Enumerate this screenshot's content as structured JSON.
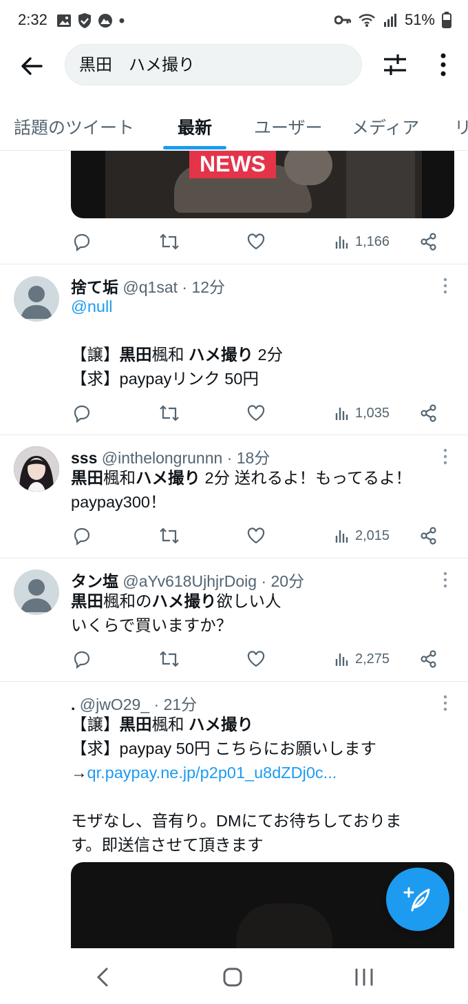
{
  "status_bar": {
    "time": "2:32",
    "battery": "51%"
  },
  "search": {
    "query": "黒田　ハメ撮り"
  },
  "tabs": [
    {
      "label": "話題のツイート"
    },
    {
      "label": "最新"
    },
    {
      "label": "ユーザー"
    },
    {
      "label": "メディア"
    },
    {
      "label": "リ"
    }
  ],
  "tweet0": {
    "media_caption": "NEWS",
    "views": "1,166"
  },
  "tweets": [
    {
      "name": "捨て垢",
      "handle": "@q1sat",
      "time": "· 12分",
      "mention": "@null",
      "line1_a": "【譲】",
      "line1_b": "黒田",
      "line1_c": "楓和 ",
      "line1_d": "ハメ撮り",
      "line1_e": " 2分",
      "line2": "【求】paypayリンク 50円",
      "views": "1,035"
    },
    {
      "name": "sss",
      "handle": "@inthelongrunnn",
      "time": "· 18分",
      "line1_a": "黒田",
      "line1_b": "楓和",
      "line1_c": "ハメ撮り",
      "line1_d": " 2分 送れるよ！もってるよ！",
      "line2": "paypay300！",
      "views": "2,015"
    },
    {
      "name": "タン塩",
      "handle": "@aYv618UjhjrDoig",
      "time": "· 20分",
      "line1_a": "黒田",
      "line1_b": "楓和の",
      "line1_c": "ハメ撮り",
      "line1_d": "欲しい人",
      "line2": "いくらで買いますか？",
      "views": "2,275"
    },
    {
      "name": ".",
      "handle": "@jwO29_",
      "time": "· 21分",
      "line1_a": "【譲】",
      "line1_b": "黒田",
      "line1_c": "楓和 ",
      "line1_d": "ハメ撮り",
      "line2": "【求】paypay 50円 こちらにお願いします",
      "arrow": "→",
      "link": "qr.paypay.ne.jp/p2p01_u8dZDj0c...",
      "line4": "モザなし、音有り。DMにてお待ちしておりま",
      "line5": "す。即送信させて頂きます"
    }
  ]
}
